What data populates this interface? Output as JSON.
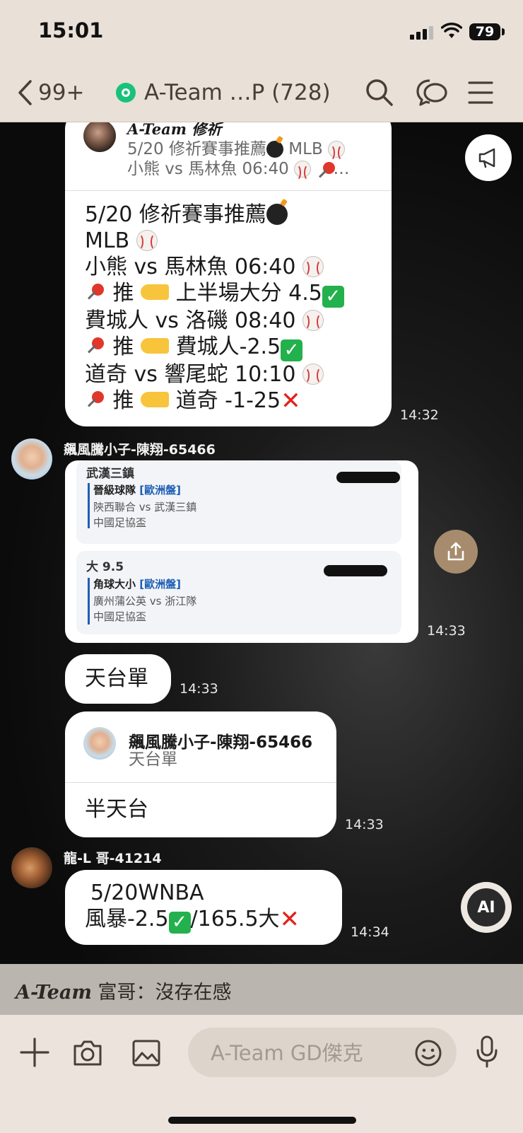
{
  "status": {
    "time": "15:01",
    "battery": "79"
  },
  "nav": {
    "back_count": "99+",
    "title": "A-Team …P (728)"
  },
  "messages": {
    "m1": {
      "reply_name": "A-Team 修祈",
      "reply_line1": "5/20 修祈賽事推薦",
      "reply_line1_tail": "MLB",
      "reply_line2": "小熊 vs 馬林魚 06:40",
      "line1": "5/20 修祈賽事推薦",
      "line2": "MLB",
      "line3": "小熊 vs 馬林魚 06:40",
      "line4a": "推",
      "line4b": "上半場大分 4.5",
      "line5": "費城人 vs 洛磯 08:40",
      "line6a": "推",
      "line6b": "費城人-2.5",
      "line7": "道奇 vs 響尾蛇 10:10",
      "line8a": "推",
      "line8b": "道奇 -1-25",
      "time": "14:32"
    },
    "m2": {
      "sender": "飆風騰小子-陳翔-65466",
      "card1_title": "武漢三鎮",
      "card1_market": "晉級球隊",
      "card1_tag": "[歐洲盤]",
      "card1_match": "陝西聯合 vs 武漢三鎮",
      "card1_league": "中國足協盃",
      "card2_title": "大 9.5",
      "card2_market": "角球大小",
      "card2_tag": "[歐洲盤]",
      "card2_match": "廣州蒲公英 vs 浙江隊",
      "card2_league": "中國足協盃",
      "time": "14:33"
    },
    "m3": {
      "text": "天台單",
      "time": "14:33"
    },
    "m4": {
      "reply_name": "飆風騰小子-陳翔-65466",
      "reply_text": "天台單",
      "text": "半天台",
      "time": "14:33"
    },
    "m5": {
      "sender": "龍-L 哥-41214",
      "line1": "5/20WNBA",
      "line2a": "風暴-2.5",
      "line2b": "/165.5大",
      "time": "14:34"
    }
  },
  "quoted": {
    "name": "A-Team",
    "text": "富哥：沒存在感"
  },
  "input": {
    "placeholder": "A-Team GD傑克"
  },
  "floating": {
    "ai_label": "AI"
  }
}
